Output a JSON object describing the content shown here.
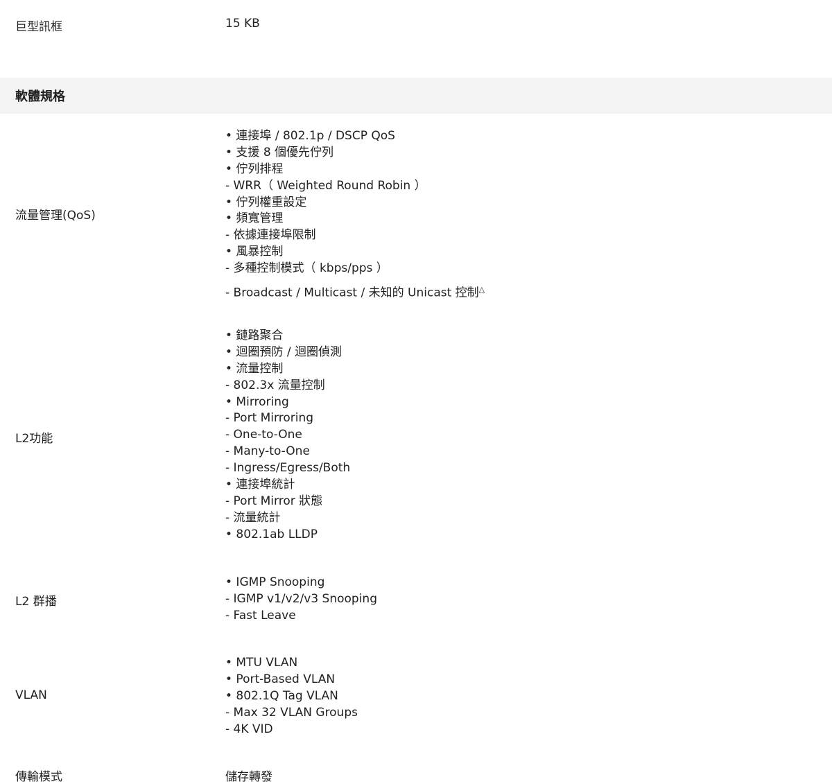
{
  "jumbo_frame": {
    "label": "巨型訊框",
    "value": "15 KB"
  },
  "section": {
    "title": "軟體規格"
  },
  "qos": {
    "label": "流量管理(QoS)",
    "lines": [
      "• 連接埠 / 802.1p / DSCP QoS",
      "• 支援 8 個優先佇列",
      "• 佇列排程",
      "- WRR（ Weighted Round Robin ）",
      "• 佇列權重設定",
      "• 頻寬管理",
      "- 依據連接埠限制",
      "• 風暴控制",
      "- 多種控制模式（ kbps/pps ）"
    ],
    "last_line": "- Broadcast / Multicast / 未知的 Unicast 控制",
    "last_line_mark": "△"
  },
  "l2": {
    "label": "L2功能",
    "lines": [
      "• 鏈路聚合",
      "• 迴圈預防 / 迴圈偵測",
      "• 流量控制",
      "- 802.3x 流量控制",
      "• Mirroring",
      "- Port Mirroring",
      "- One-to-One",
      "- Many-to-One",
      "- Ingress/Egress/Both",
      "• 連接埠統計",
      "- Port Mirror 狀態",
      "- 流量統計",
      "• 802.1ab LLDP"
    ]
  },
  "l2_multicast": {
    "label": "L2 群播",
    "lines": [
      "• IGMP Snooping",
      "- IGMP v1/v2/v3 Snooping",
      "- Fast Leave"
    ]
  },
  "vlan": {
    "label": "VLAN",
    "lines": [
      "• MTU VLAN",
      "• Port-Based VLAN",
      "• 802.1Q Tag VLAN",
      "- Max 32 VLAN Groups",
      "- 4K VID"
    ]
  },
  "transfer": {
    "label": "傳輸模式",
    "value": "儲存轉發"
  }
}
